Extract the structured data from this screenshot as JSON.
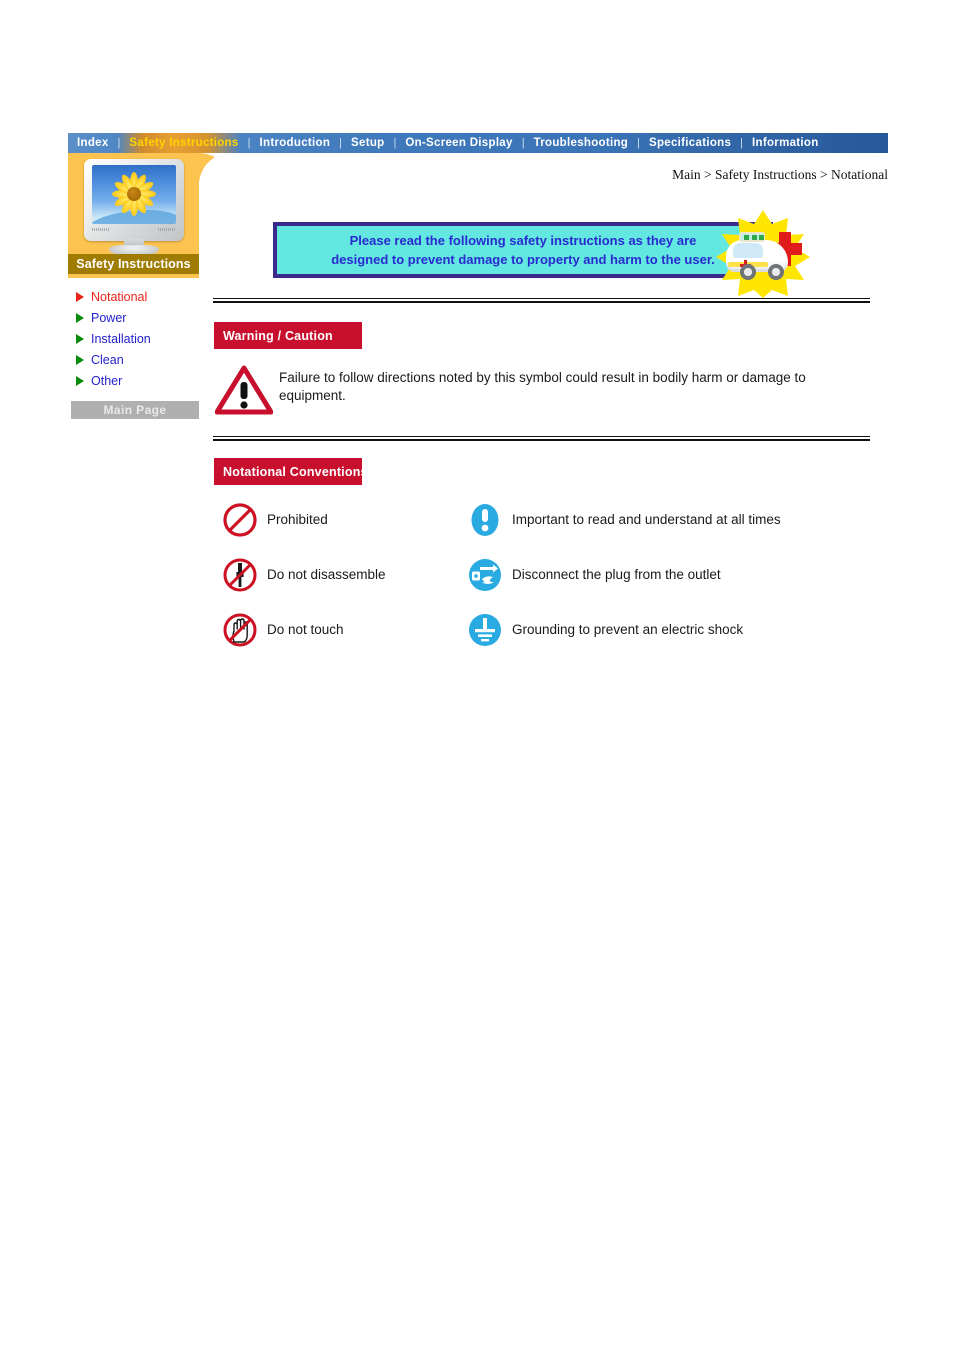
{
  "nav": {
    "items": [
      {
        "label": "Index",
        "active": false
      },
      {
        "label": "Safety Instructions",
        "active": true
      },
      {
        "label": "Introduction",
        "active": false
      },
      {
        "label": "Setup",
        "active": false
      },
      {
        "label": "On-Screen Display",
        "active": false
      },
      {
        "label": "Troubleshooting",
        "active": false
      },
      {
        "label": "Specifications",
        "active": false
      },
      {
        "label": "Information",
        "active": false
      }
    ],
    "separator": "|"
  },
  "sidebar": {
    "title": "Safety Instructions",
    "monitor_icon": "crt-monitor-sunflower-icon",
    "links": [
      {
        "label": "Notational",
        "current": true
      },
      {
        "label": "Power",
        "current": false
      },
      {
        "label": "Installation",
        "current": false
      },
      {
        "label": "Clean",
        "current": false
      },
      {
        "label": "Other",
        "current": false
      }
    ],
    "main_page_button": "Main Page"
  },
  "breadcrumb": "Main > Safety Instructions > Notational",
  "banner": {
    "text": "Please read the following safety instructions as they are\ndesigned to prevent damage to property and harm to the user.",
    "icon": "ambulance-first-aid-icon",
    "bg_color": "#62e8e0",
    "border_color": "#3a2a8c",
    "text_color": "#2a2ad0"
  },
  "warning_section": {
    "tag": "Warning / Caution",
    "tag_color": "#c8102e",
    "icon": "warning-triangle-icon",
    "body": "Failure to follow directions noted by this symbol could result in bodily harm or damage to equipment."
  },
  "notational_section": {
    "tag": "Notational Conventions",
    "tag_color": "#c8102e",
    "rows": [
      {
        "left": {
          "icon": "prohibited-icon",
          "label": "Prohibited"
        },
        "right": {
          "icon": "important-exclamation-icon",
          "label": "Important to read and understand at all times"
        }
      },
      {
        "left": {
          "icon": "do-not-disassemble-icon",
          "label": "Do not disassemble"
        },
        "right": {
          "icon": "disconnect-plug-icon",
          "label": "Disconnect the plug from the outlet"
        }
      },
      {
        "left": {
          "icon": "do-not-touch-icon",
          "label": "Do not touch"
        },
        "right": {
          "icon": "grounding-icon",
          "label": "Grounding to prevent an electric shock"
        }
      }
    ]
  },
  "colors": {
    "prohibition_red": "#cc1122",
    "mandatory_blue": "#29abe2",
    "sidebar_yellow": "#fcc34e",
    "sidebar_title_brown": "#9f7c00",
    "link_blue": "#2222cc",
    "current_link_red": "#e8241a",
    "arrow_green": "#0a8a0a"
  }
}
